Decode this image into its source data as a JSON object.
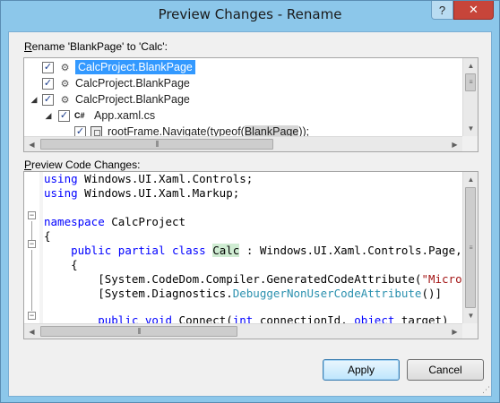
{
  "window": {
    "title": "Preview Changes - Rename",
    "help_glyph": "?",
    "close_glyph": "✕"
  },
  "rename_label": {
    "prefix": "R",
    "rest": "ename 'BlankPage' to 'Calc':"
  },
  "tree": {
    "items": [
      {
        "label": "CalcProject.BlankPage",
        "checked": true,
        "selected": true,
        "icon": "class-icon"
      },
      {
        "label": "CalcProject.BlankPage",
        "checked": true,
        "selected": false,
        "icon": "class-icon"
      },
      {
        "label": "CalcProject.BlankPage",
        "checked": true,
        "selected": false,
        "icon": "class-icon",
        "expanded": true
      },
      {
        "label": "App.xaml.cs",
        "checked": true,
        "selected": false,
        "icon": "csharp-file-icon",
        "expanded": true
      },
      {
        "label_before": "rootFrame.Navigate(typeof(",
        "label_highlight": "BlankPage",
        "label_after": "));",
        "checked": true,
        "selected": false,
        "icon": "code-reference-icon"
      }
    ],
    "checkmark": "✓",
    "csharp_icon_text": "C#"
  },
  "preview_label": {
    "prefix": "P",
    "rest": "review Code Changes:"
  },
  "code": {
    "lines": [
      {
        "t1": "using",
        "t2": " Windows.UI.Xaml.Controls;"
      },
      {
        "t1": "using",
        "t2": " Windows.UI.Xaml.Markup;"
      },
      {
        "kw": "namespace",
        "rest": " CalcProject"
      },
      {
        "text": "{"
      },
      {
        "kw1": "public",
        "kw2": "partial",
        "kw3": "class",
        "changed": "Calc",
        "rest": " : Windows.UI.Xaml.Controls.Page, ICom"
      },
      {
        "text": "{"
      },
      {
        "pre": "[System.CodeDom.Compiler.GeneratedCodeAttribute(",
        "str": "\"Microsoft."
      },
      {
        "pre": "[System.Diagnostics.",
        "ty": "DebuggerNonUserCodeAttribute",
        "post": "()]"
      },
      {
        "kw1": "public",
        "kw2": "void",
        "mid": " Connect(",
        "kw3": "int",
        "mid2": " connectionId, ",
        "kw4": "object",
        "post": " target)"
      }
    ]
  },
  "buttons": {
    "apply": "Apply",
    "cancel": "Cancel"
  },
  "scroll": {
    "up": "▲",
    "down": "▼",
    "left": "◀",
    "right": "▶",
    "grip_v": "≡",
    "grip_h": "|||"
  }
}
